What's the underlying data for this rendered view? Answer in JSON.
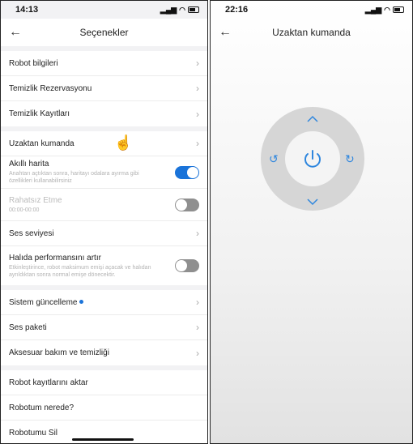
{
  "left": {
    "status": {
      "time": "14:13"
    },
    "title": "Seçenekler",
    "group1": [
      "Robot bilgileri",
      "Temizlik Rezervasyonu",
      "Temizlik Kayıtları"
    ],
    "remote_label": "Uzaktan kumanda",
    "smart_map": {
      "label": "Akıllı harita",
      "sub": "Anahtarı açtıktan sonra, haritayı odalara ayırma gibi özellikleri kullanabilirsiniz",
      "on": true
    },
    "dnd": {
      "label": "Rahatsız Etme",
      "time": "00:00-00:00",
      "on": false
    },
    "volume": "Ses seviyesi",
    "carpet": {
      "label": "Halıda performansını artır",
      "sub": "Etkinleştirince, robot maksimum emişi açacak ve halıdan ayrıldıktan sonra normal emişe dönecektir.",
      "on": false
    },
    "group3": {
      "update": "Sistem güncelleme",
      "voice_pack": "Ses paketi",
      "accessory": "Aksesuar bakım ve temizliği"
    },
    "group4": [
      "Robot kayıtlarını aktar",
      "Robotum nerede?",
      "Robotumu Sil"
    ]
  },
  "right": {
    "status": {
      "time": "22:16"
    },
    "title": "Uzaktan kumanda"
  },
  "colors": {
    "accent": "#1a73d9",
    "remote_blue": "#2e86de"
  }
}
